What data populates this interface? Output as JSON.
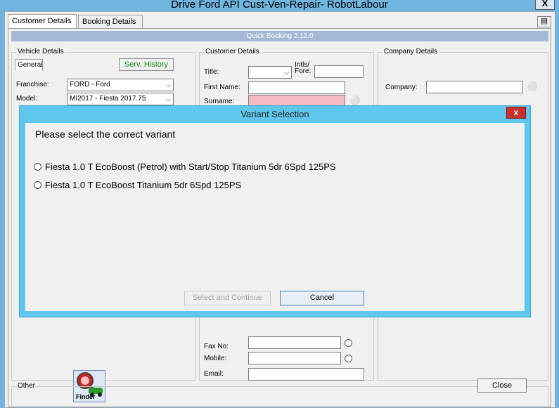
{
  "window": {
    "title": "Drive Ford API Cust-Ven-Repair- RobotLabour",
    "close_glyph": "X"
  },
  "tabs": [
    "Customer Details",
    "Booking Details"
  ],
  "banner": "Quick Booking 2.12.0",
  "vehicle": {
    "group_label": "Vehicle Details",
    "subtab": "General",
    "serv_history": "Serv. History",
    "franchise_label": "Franchise:",
    "franchise_value": "FORD - Ford",
    "model_label": "Model:",
    "model_value": "MI2017 - Fiesta 2017.75",
    "finder_label": "Finder"
  },
  "customer": {
    "group_label": "Customer Details",
    "title_label": "Title:",
    "intls_label_1": "Intls/",
    "intls_label_2": "Fore:",
    "first_name_label": "First Name:",
    "surname_label": "Surname:",
    "fax_label": "Fax No:",
    "mobile_label": "Mobile:",
    "email_label": "Email:"
  },
  "company": {
    "group_label": "Company Details",
    "company_label": "Company:"
  },
  "other": {
    "group_label": "Other"
  },
  "close_button": "Close",
  "dialog": {
    "title": "Variant Selection",
    "close_glyph": "x",
    "prompt": "Please select the correct variant",
    "options": [
      "Fiesta 1.0 T EcoBoost (Petrol) with Start/Stop Titanium 5dr 6Spd 125PS",
      "Fiesta 1.0 T EcoBoost Titanium 5dr 6Spd 125PS"
    ],
    "select_button": "Select and Continue",
    "cancel_button": "Cancel"
  }
}
